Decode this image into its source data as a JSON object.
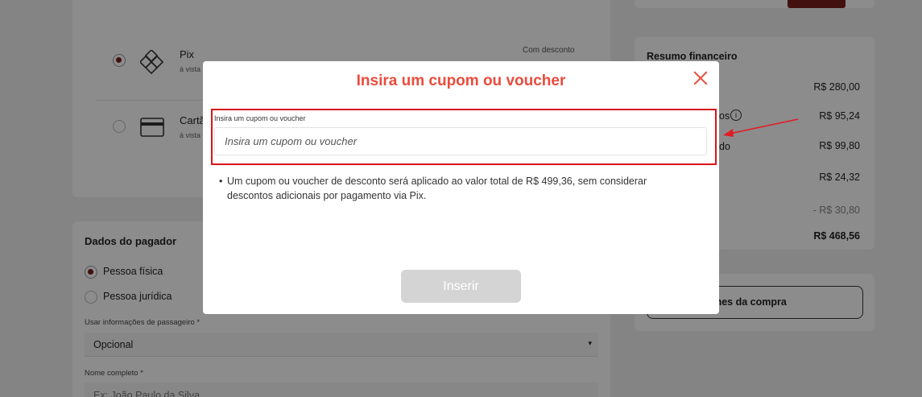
{
  "payment": {
    "pix": {
      "name": "Pix",
      "sub": "à vista",
      "tag": "Com desconto"
    },
    "card": {
      "name": "Cartã",
      "sub": "à vista"
    }
  },
  "payer": {
    "title": "Dados do pagador",
    "options": [
      "Pessoa física",
      "Pessoa jurídica"
    ],
    "passenger_label": "Usar informações de passageiro",
    "passenger_value": "Opcional",
    "name_label": "Nome completo",
    "name_placeholder": "Ex: João Paulo da Silva",
    "required_mark": "*"
  },
  "summary": {
    "title": "Resumo financeiro",
    "rows": [
      {
        "label": "",
        "value": "R$ 280,00"
      },
      {
        "label": "os",
        "value": "R$ 95,24"
      },
      {
        "label": "do",
        "value": "R$ 99,80"
      },
      {
        "label": "",
        "value": "R$ 24,32"
      },
      {
        "label": "",
        "value": "- R$ 30,80"
      },
      {
        "label": "",
        "value": "R$ 468,56"
      }
    ],
    "details_button": "talhes da compra"
  },
  "modal": {
    "title": "Insira um cupom ou voucher",
    "input_label": "Insira um cupom ou voucher",
    "input_placeholder": "Insira um cupom ou voucher",
    "note": "Um cupom ou voucher de desconto será aplicado ao valor total de R$ 499,36, sem considerar descontos adicionais por pagamento via Pix.",
    "insert_label": "Inserir"
  },
  "colors": {
    "accent": "#e94c3d",
    "highlight": "#d9141a",
    "button_disabled": "#d4d4d4"
  }
}
